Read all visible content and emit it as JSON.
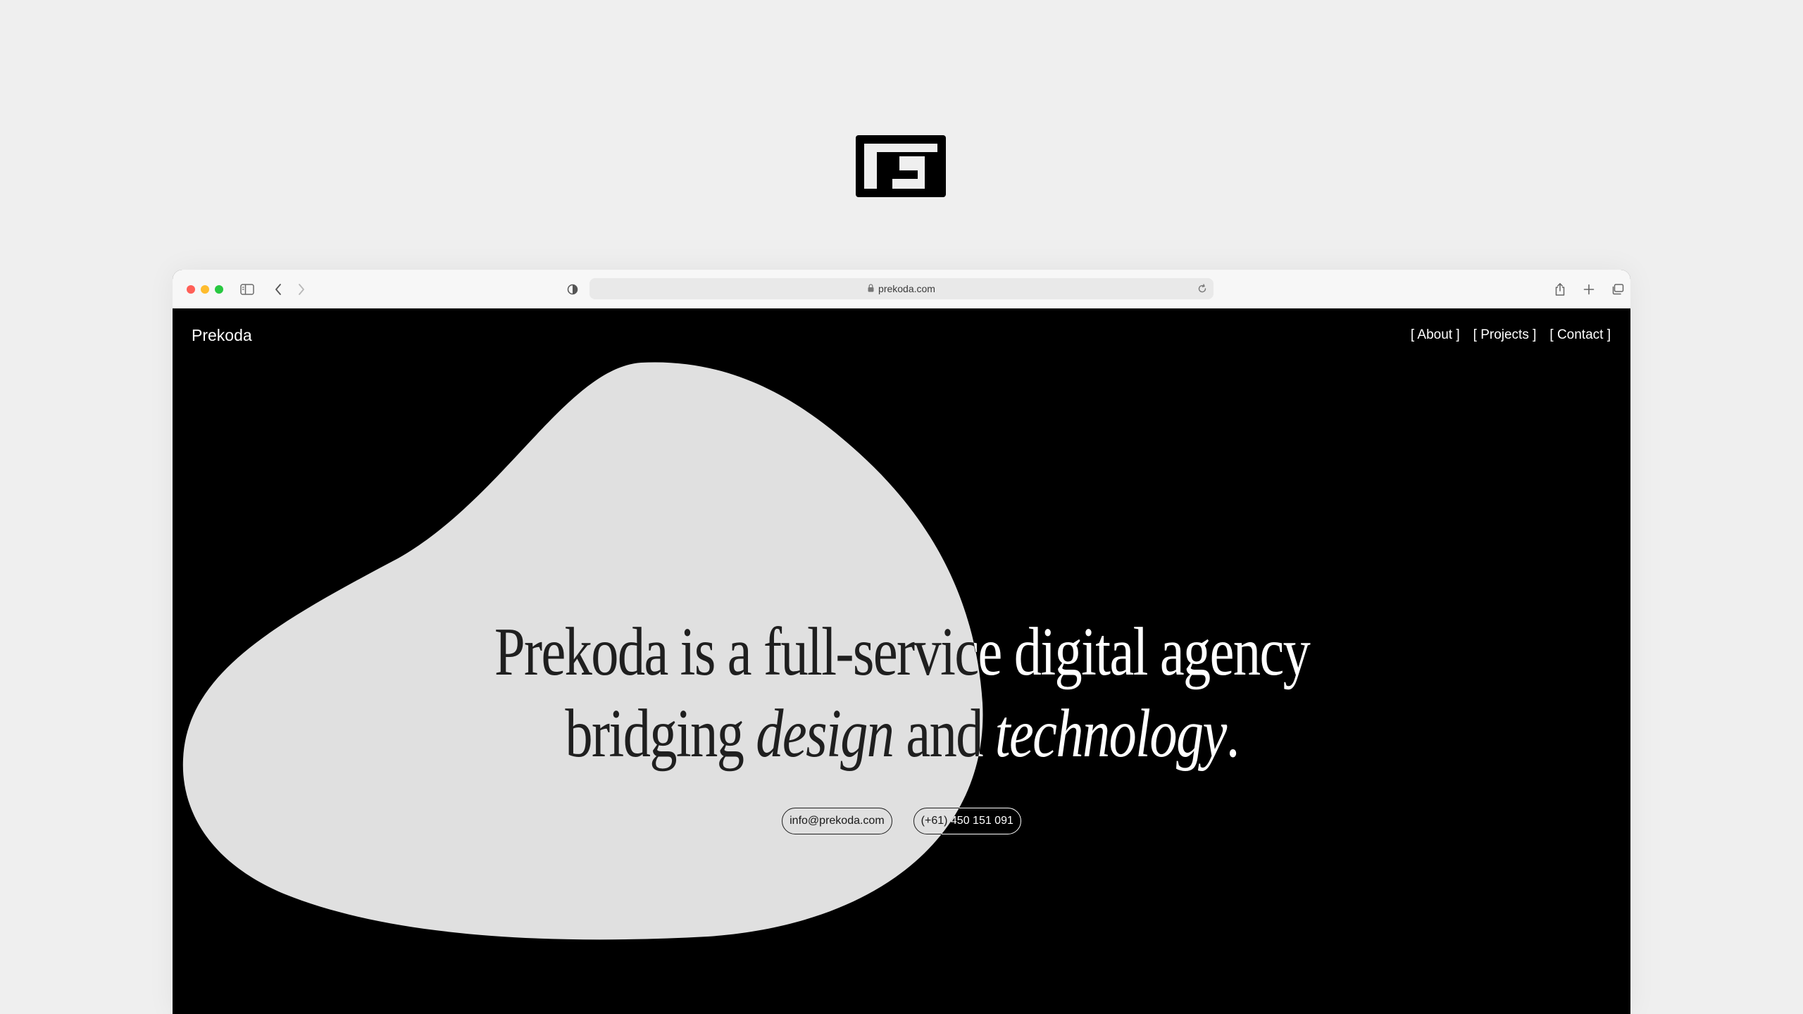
{
  "browser": {
    "url": "prekoda.com"
  },
  "site": {
    "brand": "Prekoda",
    "nav": [
      {
        "label": "[ About ]"
      },
      {
        "label": "[ Projects ]"
      },
      {
        "label": "[ Contact ]"
      }
    ],
    "headline": {
      "line1": "Prekoda is a full-service digital agency",
      "line2_part1": "bridging ",
      "line2_emph1": "design",
      "line2_part2": " and ",
      "line2_emph2": "technology",
      "line2_part3": "."
    },
    "contact": {
      "email": "info@prekoda.com",
      "phone": "(+61) 450 151 091"
    }
  },
  "colors": {
    "background": "#efefef",
    "page": "#000000",
    "blob": "#e0e0e0",
    "text": "#ffffff"
  },
  "icons": [
    "prekoda-logo-icon",
    "sidebar-icon",
    "back-icon",
    "forward-icon",
    "shield-icon",
    "lock-icon",
    "reload-icon",
    "share-icon",
    "new-tab-icon",
    "tabs-overview-icon"
  ]
}
